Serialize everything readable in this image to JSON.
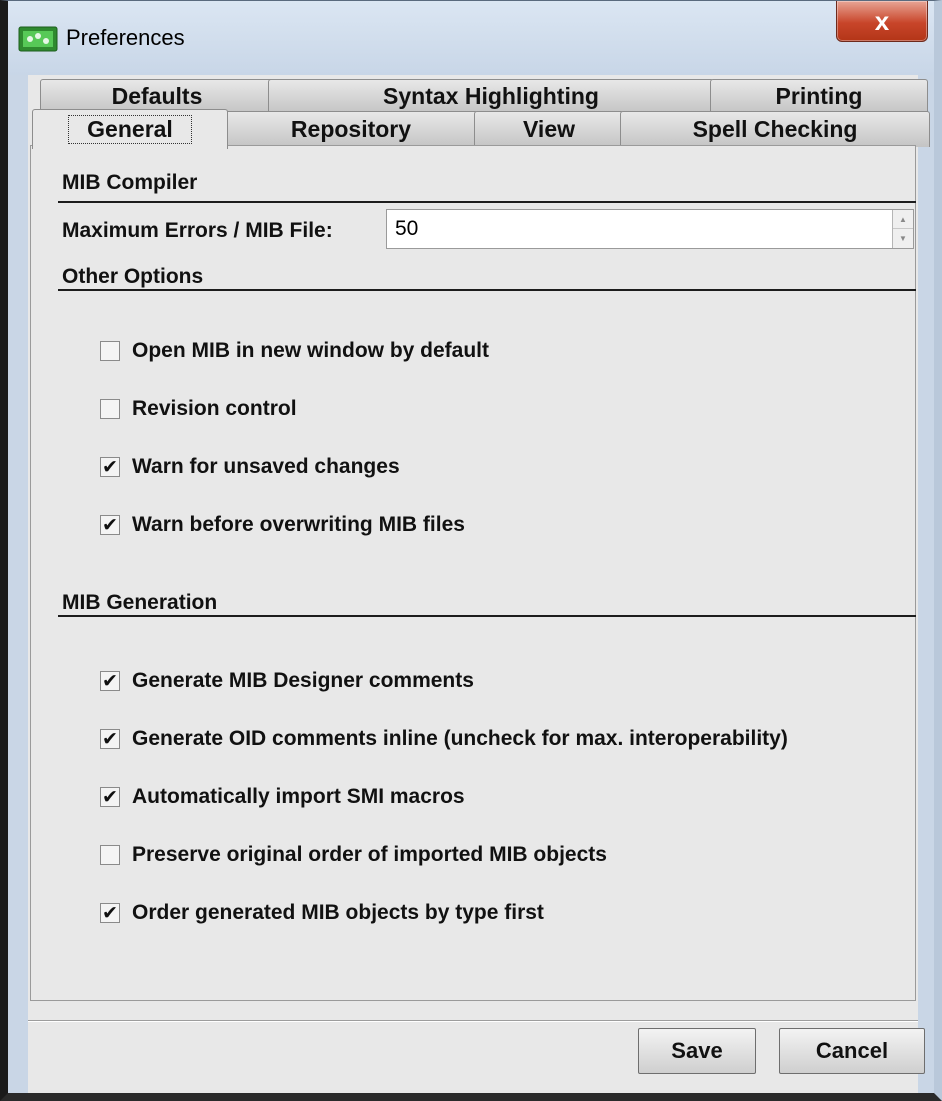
{
  "window": {
    "title": "Preferences",
    "close_label": "x"
  },
  "tabs": {
    "row1": [
      {
        "label": "Defaults"
      },
      {
        "label": "Syntax Highlighting"
      },
      {
        "label": "Printing"
      }
    ],
    "row2": [
      {
        "label": "General",
        "active": true
      },
      {
        "label": "Repository"
      },
      {
        "label": "View"
      },
      {
        "label": "Spell Checking"
      }
    ]
  },
  "compiler": {
    "title": "MIB Compiler",
    "max_errors_label": "Maximum Errors / MIB File:",
    "max_errors_value": "50"
  },
  "other": {
    "title": "Other Options",
    "options": [
      {
        "label": "Open MIB in new window by default",
        "checked": false
      },
      {
        "label": "Revision control",
        "checked": false
      },
      {
        "label": "Warn for unsaved changes",
        "checked": true
      },
      {
        "label": "Warn before overwriting MIB files",
        "checked": true
      }
    ]
  },
  "generation": {
    "title": "MIB Generation",
    "options": [
      {
        "label": "Generate MIB Designer comments",
        "checked": true
      },
      {
        "label": "Generate OID comments inline (uncheck for max. interoperability)",
        "checked": true
      },
      {
        "label": "Automatically import SMI macros",
        "checked": true
      },
      {
        "label": "Preserve original order of imported MIB objects",
        "checked": false
      },
      {
        "label": "Order generated MIB objects by type first",
        "checked": true
      }
    ]
  },
  "buttons": {
    "save": "Save",
    "cancel": "Cancel"
  },
  "check_mark": "✔"
}
